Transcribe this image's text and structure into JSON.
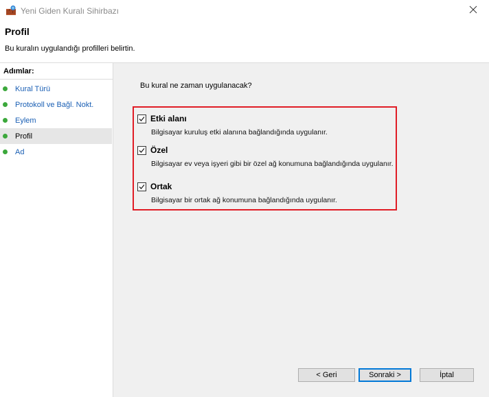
{
  "window": {
    "title": "Yeni Giden Kuralı Sihirbazı"
  },
  "header": {
    "title": "Profil",
    "subtitle": "Bu kuralın uygulandığı profilleri belirtin."
  },
  "sidebar": {
    "heading": "Adımlar:",
    "items": [
      {
        "label": "Kural Türü",
        "active": false
      },
      {
        "label": "Protokoll ve Bağl. Nokt.",
        "active": false
      },
      {
        "label": "Eylem",
        "active": false
      },
      {
        "label": "Profil",
        "active": true
      },
      {
        "label": "Ad",
        "active": false
      }
    ]
  },
  "main": {
    "question": "Bu kural ne zaman uygulanacak?",
    "options": [
      {
        "label": "Etki alanı",
        "checked": true,
        "description": "Bilgisayar kuruluş etki alanına bağlandığında uygulanır."
      },
      {
        "label": "Özel",
        "checked": true,
        "description": "Bilgisayar ev veya işyeri gibi bir özel ağ konumuna bağlandığında uygulanır."
      },
      {
        "label": "Ortak",
        "checked": true,
        "description": "Bilgisayar bir ortak ağ konumuna bağlandığında uygulanır."
      }
    ]
  },
  "buttons": {
    "back": "< Geri",
    "next": "Sonraki >",
    "cancel": "İptal"
  },
  "colors": {
    "highlight": "#e01b24",
    "step_dot": "#3ca83c",
    "link": "#1a5fb4",
    "accent": "#0078d7"
  },
  "icons": {
    "app": "firewall-icon",
    "close": "close-icon",
    "step": "green-dot-icon",
    "check": "check-icon"
  }
}
